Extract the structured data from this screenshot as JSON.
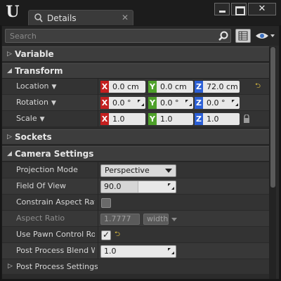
{
  "window": {
    "tab_title": "Details",
    "close_glyph": "✕"
  },
  "search": {
    "placeholder": "Search"
  },
  "categories": {
    "variable": "Variable",
    "transform": "Transform",
    "sockets": "Sockets",
    "camera_settings": "Camera Settings",
    "post_process_settings": "Post Process Settings"
  },
  "transform": {
    "location": {
      "label": "Location",
      "x": "0.0 cm",
      "y": "0.0 cm",
      "z": "72.0 cm"
    },
    "rotation": {
      "label": "Rotation",
      "x": "0.0 °",
      "y": "0.0 °",
      "z": "0.0 °"
    },
    "scale": {
      "label": "Scale",
      "x": "1.0",
      "y": "1.0",
      "z": "1.0"
    }
  },
  "axis_labels": {
    "x": "X",
    "y": "Y",
    "z": "Z"
  },
  "camera": {
    "projection_mode": {
      "label": "Projection Mode",
      "value": "Perspective"
    },
    "field_of_view": {
      "label": "Field Of View",
      "value": "90.0",
      "slider_fraction": 0.5
    },
    "constrain_aspect_ratio": {
      "label": "Constrain Aspect Ratio",
      "checked": false
    },
    "aspect_ratio": {
      "label": "Aspect Ratio",
      "value": "1.7777",
      "unit": "width"
    },
    "use_pawn_control_rotation": {
      "label": "Use Pawn Control Rotation",
      "checked": true
    },
    "post_process_blend_weight": {
      "label": "Post Process Blend Weight",
      "value": "1.0"
    }
  },
  "icons": {
    "logo": "unreal-logo-icon",
    "search": "search-icon",
    "grid": "property-matrix-icon",
    "eye": "eye-icon",
    "reset": "reset-to-default-icon",
    "lock": "lock-icon"
  },
  "colors": {
    "x_axis": "#c42020",
    "y_axis": "#4ea12a",
    "z_axis": "#2b5fd6",
    "reset": "#e0c040"
  }
}
